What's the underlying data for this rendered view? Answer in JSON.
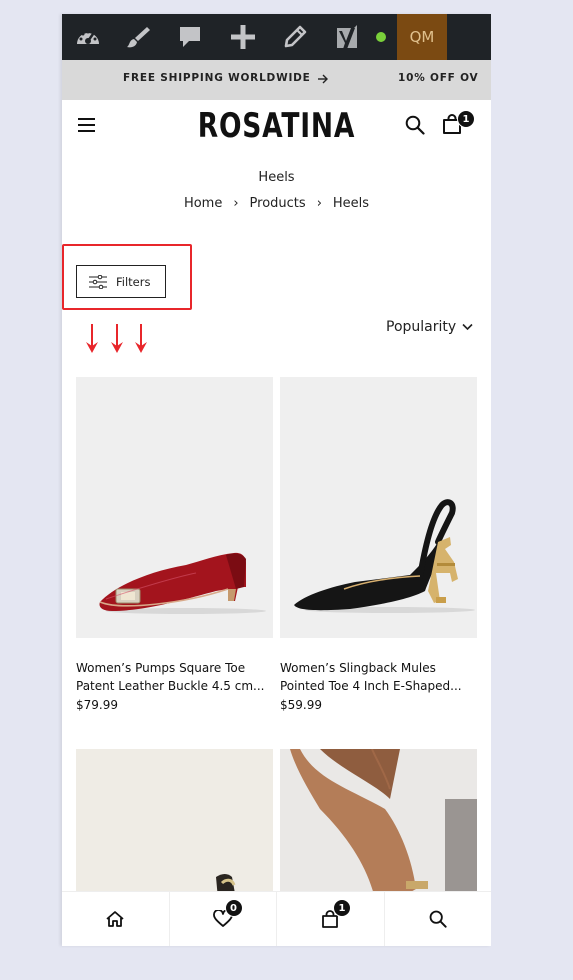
{
  "admin_bar": {
    "icons": [
      "dashboard-icon",
      "customize-brush-icon",
      "comments-icon",
      "add-new-icon",
      "edit-pencil-icon",
      "yoast-seo-icon"
    ],
    "status_dot_color": "#7ad03a",
    "qm_label": "QM",
    "qm_bg": "#7b4a12",
    "qm_color": "#e0c08c",
    "bg_color": "#1f2327"
  },
  "promo": {
    "shipping_text": "FREE SHIPPING WORLDWIDE",
    "discount_text": "10% OFF OV"
  },
  "header": {
    "logo": "ROSATINA",
    "cart_count": "1"
  },
  "breadcrumb": {
    "page_title": "Heels",
    "items": [
      "Home",
      "Products",
      "Heels"
    ],
    "separator": "›"
  },
  "toolbar": {
    "filters_label": "Filters",
    "sort_label": "Popularity",
    "highlight_color": "#e8262b"
  },
  "products": [
    {
      "title": "Women’s Pumps Square Toe",
      "title2": "Patent Leather Buckle 4.5 cm...",
      "price": "$79.99"
    },
    {
      "title": "Women’s Slingback Mules",
      "title2": "Pointed Toe 4 Inch E-Shaped...",
      "price": "$59.99"
    }
  ],
  "bottom_nav": {
    "items": [
      "home-icon",
      "wishlist-icon",
      "cart-icon",
      "search-icon"
    ],
    "wishlist_count": "0",
    "cart_count": "1"
  }
}
